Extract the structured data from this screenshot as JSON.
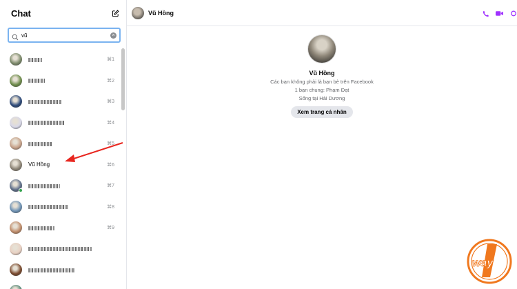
{
  "sidebar": {
    "title": "Chat",
    "search": {
      "value": "vũ",
      "placeholder": ""
    },
    "items": [
      {
        "name": "",
        "shortcut": "⌘1",
        "avatar_color": "#7c8a6b",
        "online": false,
        "redacted_width": 20
      },
      {
        "name": "",
        "shortcut": "⌘2",
        "avatar_color": "#6e8c4b",
        "online": false,
        "redacted_width": 24
      },
      {
        "name": "",
        "shortcut": "⌘3",
        "avatar_color": "#2d4a7a",
        "online": false,
        "redacted_width": 48
      },
      {
        "name": "",
        "shortcut": "⌘4",
        "avatar_color": "#d8d8e8",
        "online": false,
        "redacted_width": 52
      },
      {
        "name": "",
        "shortcut": "⌘5",
        "avatar_color": "#c7a28a",
        "online": false,
        "redacted_width": 34
      },
      {
        "name": "Vũ Hồng",
        "shortcut": "⌘6",
        "avatar_color": "#8e8678",
        "online": false,
        "redacted_width": 0
      },
      {
        "name": "",
        "shortcut": "⌘7",
        "avatar_color": "#5f6f8a",
        "online": true,
        "redacted_width": 46
      },
      {
        "name": "",
        "shortcut": "⌘8",
        "avatar_color": "#6f93b5",
        "online": false,
        "redacted_width": 58
      },
      {
        "name": "",
        "shortcut": "⌘9",
        "avatar_color": "#c08d6b",
        "online": false,
        "redacted_width": 38
      },
      {
        "name": "",
        "shortcut": "",
        "avatar_color": "#e8d0c2",
        "online": false,
        "redacted_width": 92
      },
      {
        "name": "",
        "shortcut": "",
        "avatar_color": "#7a4a2e",
        "online": false,
        "redacted_width": 68
      },
      {
        "name": "",
        "shortcut": "",
        "avatar_color": "#5a8a7a",
        "online": false,
        "redacted_width": 40
      }
    ]
  },
  "conversation": {
    "name": "Vũ Hồng",
    "profile": {
      "name": "Vũ Hồng",
      "lines": [
        "Các bạn không phải là bạn bè trên Facebook",
        "1 bạn chung: Phạm Đạt",
        "Sống tại Hải Dương"
      ],
      "button_label": "Xem trang cá nhân"
    },
    "actions": [
      "phone-icon",
      "video-icon",
      "search-icon"
    ]
  },
  "colors": {
    "accent": "#a033ff",
    "annotation_arrow": "#e8261f",
    "logo_orange": "#f0781e"
  },
  "logo": {
    "text": "way"
  }
}
